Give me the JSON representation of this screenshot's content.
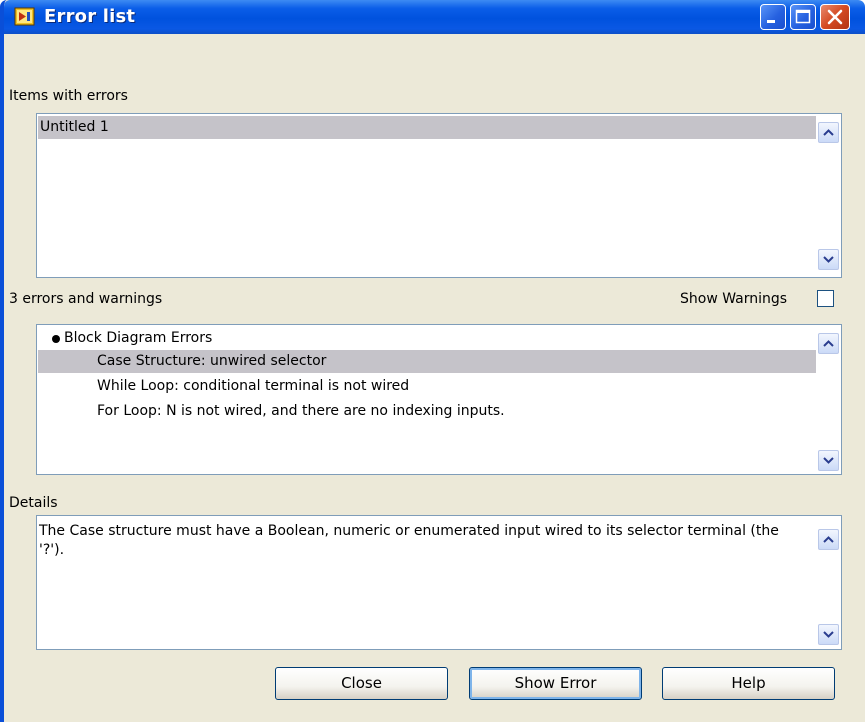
{
  "window": {
    "title": "Error list",
    "icon": "labview-vi-icon"
  },
  "titlebar_buttons": [
    "minimize",
    "maximize",
    "close"
  ],
  "items_section": {
    "label": "Items with errors",
    "items": [
      "Untitled 1"
    ],
    "selected_index": 0
  },
  "errors_section": {
    "count_label": "3 errors and warnings",
    "show_warnings_label": "Show Warnings",
    "show_warnings_checked": false,
    "group": "Block Diagram Errors",
    "errors": [
      "Case Structure: unwired selector",
      "While Loop: conditional terminal is not wired",
      "For Loop: N is not wired, and there are no indexing inputs."
    ],
    "selected_index": 0
  },
  "details_section": {
    "label": "Details",
    "text": "The Case structure must have a Boolean, numeric or enumerated input wired to its selector terminal (the '?')."
  },
  "buttons": {
    "close": "Close",
    "show_error": "Show Error",
    "help": "Help"
  },
  "colors": {
    "titlebar": "#0052de",
    "dialog_bg": "#ece9d8",
    "selection": "#c5c3c9",
    "list_border": "#7f9db9"
  }
}
